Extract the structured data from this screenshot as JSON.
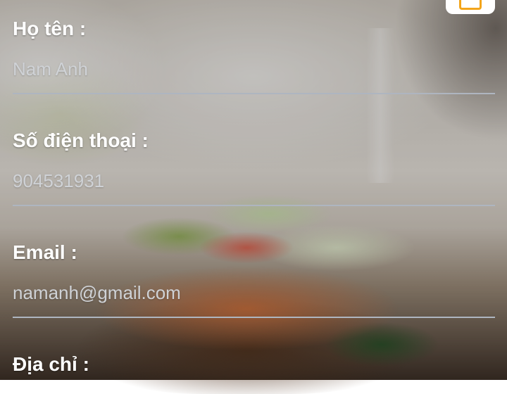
{
  "top_button": {
    "icon": "folder-icon",
    "accent_color": "#f3a51b"
  },
  "fields": [
    {
      "label": "Họ tên :",
      "value": "Nam Anh"
    },
    {
      "label": "Số điện thoại :",
      "value": "904531931"
    },
    {
      "label": "Email :",
      "value": "namanh@gmail.com"
    },
    {
      "label": "Địa chỉ :",
      "value": ""
    }
  ],
  "colors": {
    "label_text": "#ffffff",
    "value_text": "#cfd2d6",
    "underline": "#aeb5c0"
  }
}
